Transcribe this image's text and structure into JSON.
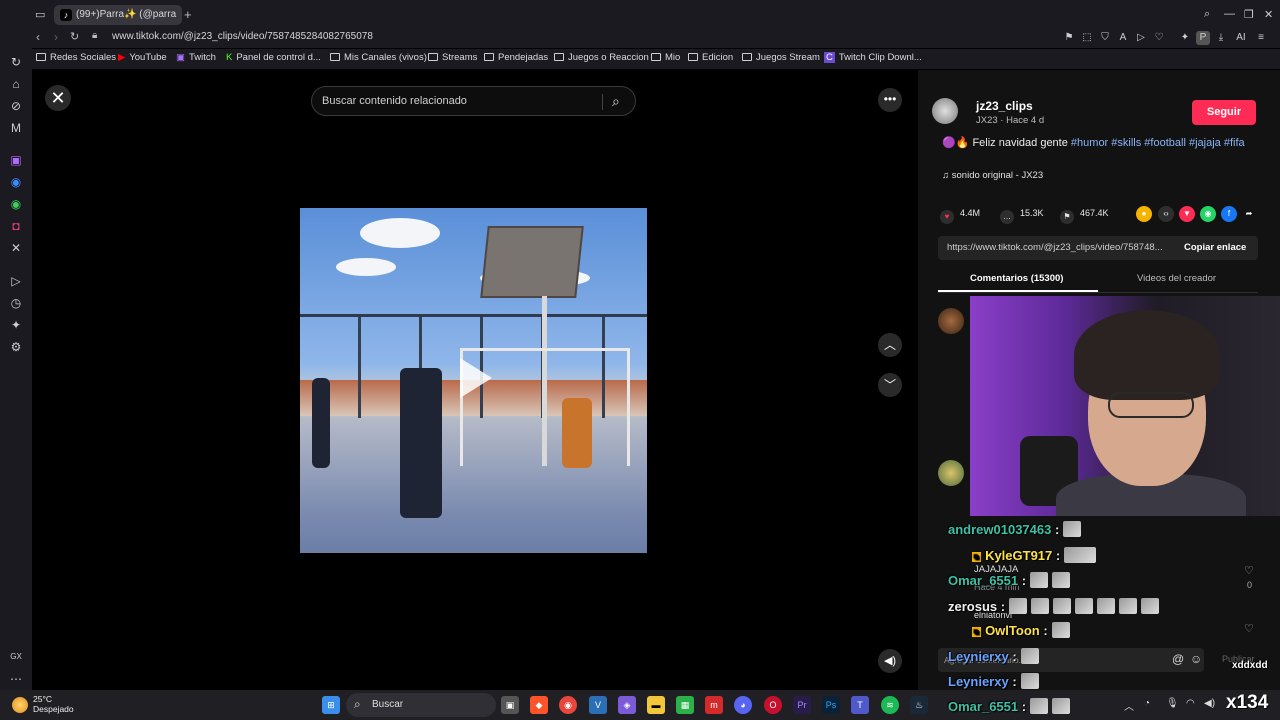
{
  "browser": {
    "tab_label": "(99+)Parra✨ (@parra",
    "url": "www.tiktok.com/@jz23_clips/video/7587485284082765078",
    "bookmarks": [
      "Redes Sociales",
      "YouTube",
      "Twitch",
      "Panel de control d...",
      "Mis Canales (vivos)",
      "Streams",
      "Pendejadas",
      "Juegos o Reaccion",
      "Mio",
      "Edicion",
      "Juegos Stream",
      "Twitch Clip Downl..."
    ],
    "ext_badge": "AI"
  },
  "player": {
    "search_placeholder": "Buscar contenido relacionado"
  },
  "post": {
    "username": "jz23_clips",
    "meta": "JX23 · Hace 4 d",
    "follow_label": "Seguir",
    "caption_prefix": "Feliz navidad gente",
    "hashtags": [
      "#humor",
      "#skills",
      "#football",
      "#jajaja",
      "#fifa"
    ],
    "sound": "sonido original - JX23",
    "likes": "4.4M",
    "comments": "15.3K",
    "saves": "467.4K",
    "link": "https://www.tiktok.com/@jz23_clips/video/758748...",
    "copy_label": "Copiar enlace",
    "tab_comments": "Comentarios (15300)",
    "tab_creator": "Videos del creador",
    "comment_placeholder": "Agregar comentario...",
    "post_label": "Publicar",
    "comment_text": "JAJAJAJA",
    "comment_time": "Hace 4 min",
    "comment_likes": "0",
    "comment_user2": "elniatonvl"
  },
  "chat": [
    {
      "user": "andrew01037463",
      "color": "#3ec1a6"
    },
    {
      "user": "KyleGT917",
      "color": "#ffe24a"
    },
    {
      "user": "Omar_6551",
      "color": "#3ec1a6"
    },
    {
      "user": "zerosus",
      "color": "#f0f0f0"
    },
    {
      "user": "OwlToon",
      "color": "#ffe24a"
    },
    {
      "user": "Leynierxy",
      "color": "#6aa3ff"
    },
    {
      "user": "Leynierxy",
      "color": "#6aa3ff"
    },
    {
      "user": "Omar_6551",
      "color": "#3ec1a6"
    }
  ],
  "chat_misc": {
    "colon": ":",
    "corner_text": "xddxdd",
    "big_number": "x134"
  },
  "taskbar": {
    "temp": "25°C",
    "weather": "Despejado",
    "search_label": "Buscar"
  },
  "sidebar_bottom": "GX"
}
